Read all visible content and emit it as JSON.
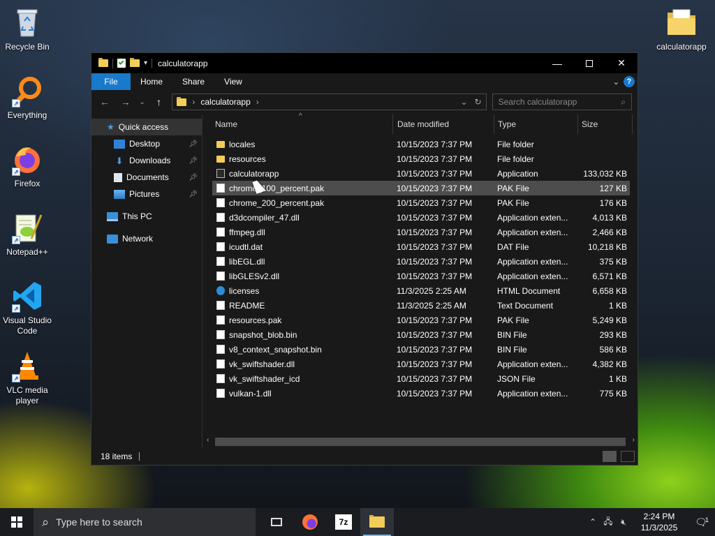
{
  "desktop": {
    "icons_left": [
      {
        "label": "Recycle Bin",
        "icon": "recycle-bin-icon"
      },
      {
        "label": "Everything",
        "icon": "everything-search-icon"
      },
      {
        "label": "Firefox",
        "icon": "firefox-icon"
      },
      {
        "label": "Notepad++",
        "icon": "notepadpp-icon"
      },
      {
        "label": "Visual Studio Code",
        "icon": "vscode-icon"
      },
      {
        "label": "VLC media player",
        "icon": "vlc-icon"
      }
    ],
    "icon_right": {
      "label": "calculatorapp",
      "icon": "folder-icon"
    }
  },
  "window": {
    "title": "calculatorapp",
    "ribbon_tabs": [
      "File",
      "Home",
      "Share",
      "View"
    ],
    "help": "?",
    "address": {
      "crumbs": [
        "calculatorapp"
      ]
    },
    "search_placeholder": "Search calculatorapp",
    "nav": {
      "quick_access": "Quick access",
      "pinned": [
        {
          "label": "Desktop",
          "icon": "desktop-icon"
        },
        {
          "label": "Downloads",
          "icon": "downloads-icon"
        },
        {
          "label": "Documents",
          "icon": "documents-icon"
        },
        {
          "label": "Pictures",
          "icon": "pictures-icon"
        }
      ],
      "this_pc": "This PC",
      "network": "Network"
    },
    "columns": {
      "name": "Name",
      "date": "Date modified",
      "type": "Type",
      "size": "Size"
    },
    "files": [
      {
        "name": "locales",
        "date": "10/15/2023 7:37 PM",
        "type": "File folder",
        "size": "",
        "icon": "folder"
      },
      {
        "name": "resources",
        "date": "10/15/2023 7:37 PM",
        "type": "File folder",
        "size": "",
        "icon": "folder"
      },
      {
        "name": "calculatorapp",
        "date": "10/15/2023 7:37 PM",
        "type": "Application",
        "size": "133,032 KB",
        "icon": "app"
      },
      {
        "name": "chrome_100_percent.pak",
        "date": "10/15/2023 7:37 PM",
        "type": "PAK File",
        "size": "127 KB",
        "icon": "file"
      },
      {
        "name": "chrome_200_percent.pak",
        "date": "10/15/2023 7:37 PM",
        "type": "PAK File",
        "size": "176 KB",
        "icon": "file"
      },
      {
        "name": "d3dcompiler_47.dll",
        "date": "10/15/2023 7:37 PM",
        "type": "Application exten...",
        "size": "4,013 KB",
        "icon": "file"
      },
      {
        "name": "ffmpeg.dll",
        "date": "10/15/2023 7:37 PM",
        "type": "Application exten...",
        "size": "2,466 KB",
        "icon": "file"
      },
      {
        "name": "icudtl.dat",
        "date": "10/15/2023 7:37 PM",
        "type": "DAT File",
        "size": "10,218 KB",
        "icon": "file"
      },
      {
        "name": "libEGL.dll",
        "date": "10/15/2023 7:37 PM",
        "type": "Application exten...",
        "size": "375 KB",
        "icon": "file"
      },
      {
        "name": "libGLESv2.dll",
        "date": "10/15/2023 7:37 PM",
        "type": "Application exten...",
        "size": "6,571 KB",
        "icon": "file"
      },
      {
        "name": "licenses",
        "date": "11/3/2025 2:25 AM",
        "type": "HTML Document",
        "size": "6,658 KB",
        "icon": "html"
      },
      {
        "name": "README",
        "date": "11/3/2025 2:25 AM",
        "type": "Text Document",
        "size": "1 KB",
        "icon": "file"
      },
      {
        "name": "resources.pak",
        "date": "10/15/2023 7:37 PM",
        "type": "PAK File",
        "size": "5,249 KB",
        "icon": "file"
      },
      {
        "name": "snapshot_blob.bin",
        "date": "10/15/2023 7:37 PM",
        "type": "BIN File",
        "size": "293 KB",
        "icon": "file"
      },
      {
        "name": "v8_context_snapshot.bin",
        "date": "10/15/2023 7:37 PM",
        "type": "BIN File",
        "size": "586 KB",
        "icon": "file"
      },
      {
        "name": "vk_swiftshader.dll",
        "date": "10/15/2023 7:37 PM",
        "type": "Application exten...",
        "size": "4,382 KB",
        "icon": "file"
      },
      {
        "name": "vk_swiftshader_icd",
        "date": "10/15/2023 7:37 PM",
        "type": "JSON File",
        "size": "1 KB",
        "icon": "file"
      },
      {
        "name": "vulkan-1.dll",
        "date": "10/15/2023 7:37 PM",
        "type": "Application exten...",
        "size": "775 KB",
        "icon": "file"
      }
    ],
    "hovered_index": 3,
    "status": "18 items"
  },
  "taskbar": {
    "search_placeholder": "Type here to search",
    "time": "2:24 PM",
    "date": "11/3/2025",
    "notification_count": "1"
  },
  "colors": {
    "accent": "#1979ca",
    "folder": "#f3cd59",
    "window_bg": "#191919"
  }
}
